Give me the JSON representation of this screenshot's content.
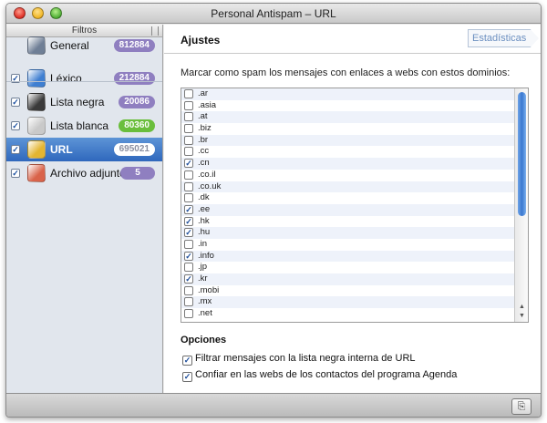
{
  "window": {
    "title": "Personal Antispam – URL"
  },
  "sidebar": {
    "header": "Filtros",
    "items": [
      {
        "label": "General",
        "badge": "812884",
        "badge_color": "#8f7fc0",
        "checkbox": false,
        "icon": "general-icon",
        "icon_color": "#6f7f96"
      },
      {
        "label": "Léxico",
        "badge": "212884",
        "badge_color": "#8f7fc0",
        "checkbox": true,
        "checked": true,
        "icon": "lexicon-icon",
        "icon_color": "#3f7fd1"
      },
      {
        "label": "Lista negra",
        "badge": "20086",
        "badge_color": "#8f7fc0",
        "checkbox": true,
        "checked": true,
        "icon": "blacklist-icon",
        "icon_color": "#3a3a3a"
      },
      {
        "label": "Lista blanca",
        "badge": "80360",
        "badge_color": "#6abe3c",
        "checkbox": true,
        "checked": true,
        "icon": "whitelist-icon",
        "icon_color": "#c9c9c9"
      },
      {
        "label": "URL",
        "badge": "695021",
        "badge_color": "#8f7fc0",
        "checkbox": true,
        "checked": true,
        "icon": "url-icon",
        "icon_color": "#e3b531",
        "selected": true
      },
      {
        "label": "Archivo adjunto",
        "badge": "5",
        "badge_color": "#8f7fc0",
        "checkbox": true,
        "checked": true,
        "icon": "attachment-icon",
        "icon_color": "#d9634a"
      }
    ]
  },
  "main": {
    "title": "Ajustes",
    "stats_button": "Estadísticas",
    "instruction": "Marcar como spam los mensajes con enlaces a webs con estos dominios:",
    "domains": [
      {
        "name": ".ar",
        "checked": false
      },
      {
        "name": ".asia",
        "checked": false
      },
      {
        "name": ".at",
        "checked": false
      },
      {
        "name": ".biz",
        "checked": false
      },
      {
        "name": ".br",
        "checked": false
      },
      {
        "name": ".cc",
        "checked": false
      },
      {
        "name": ".cn",
        "checked": true
      },
      {
        "name": ".co.il",
        "checked": false
      },
      {
        "name": ".co.uk",
        "checked": false
      },
      {
        "name": ".dk",
        "checked": false
      },
      {
        "name": ".ee",
        "checked": true
      },
      {
        "name": ".hk",
        "checked": true
      },
      {
        "name": ".hu",
        "checked": true
      },
      {
        "name": ".in",
        "checked": false
      },
      {
        "name": ".info",
        "checked": true
      },
      {
        "name": ".jp",
        "checked": false
      },
      {
        "name": ".kr",
        "checked": true
      },
      {
        "name": ".mobi",
        "checked": false
      },
      {
        "name": ".mx",
        "checked": false
      },
      {
        "name": ".net",
        "checked": false
      }
    ],
    "options_title": "Opciones",
    "options": [
      {
        "label": "Filtrar mensajes con la lista negra interna de URL",
        "checked": true
      },
      {
        "label": "Confiar en las webs de los contactos del programa Agenda",
        "checked": true
      }
    ]
  },
  "bottombar": {
    "icon": "export-icon"
  }
}
